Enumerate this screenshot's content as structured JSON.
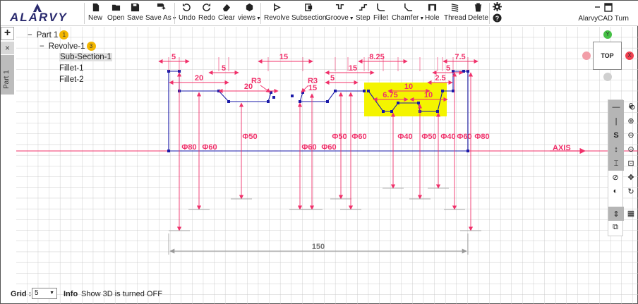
{
  "app": {
    "brand": "ALARVY",
    "product": "AlarvyCAD Turn"
  },
  "toolbar": {
    "new": "New",
    "open": "Open",
    "save": "Save",
    "save_as": "Save As",
    "undo": "Undo",
    "redo": "Redo",
    "clear": "Clear",
    "views": "views",
    "revolve": "Revolve",
    "subsection": "Subsection",
    "groove": "Groove",
    "step": "Step",
    "fillet": "Fillet",
    "chamfer": "Chamfer",
    "hole": "Hole",
    "thread": "Thread",
    "delete": "Delete"
  },
  "tree": {
    "part": "Part 1",
    "part_badge": "1",
    "revolve": "Revolve-1",
    "revolve_badge": "3",
    "items": [
      "Sub-Section-1",
      "Fillet-1",
      "Fillet-2"
    ]
  },
  "left_tab": {
    "add": "+",
    "close": "×",
    "part": "Part 1"
  },
  "viewcube": {
    "face": "TOP",
    "y": "Y",
    "x": "X"
  },
  "status": {
    "grid_label": "Grid :",
    "grid_value": "5",
    "info_label": "Info",
    "info_text": "Show 3D is turned OFF"
  },
  "colors": {
    "dimension": "#f0306a",
    "geometry": "#1a1aa8",
    "highlight": "#f4f400",
    "grid": "#c8c8c8",
    "axis": "#f0306a"
  },
  "sketch": {
    "axis_label": "AXIS",
    "dimensions": {
      "total_length": "150",
      "top": [
        "5",
        "20",
        "5",
        "15",
        "R3",
        "20",
        "R3",
        "15",
        "5",
        "15",
        "8.25",
        "6.75",
        "10",
        "10",
        "2.5",
        "5",
        "7.5"
      ],
      "diameters": [
        "Φ80",
        "Φ60",
        "Φ50",
        "Φ60",
        "Φ60",
        "Φ50",
        "Φ60",
        "Φ40",
        "Φ50",
        "Φ40",
        "Φ60",
        "Φ80"
      ]
    }
  }
}
